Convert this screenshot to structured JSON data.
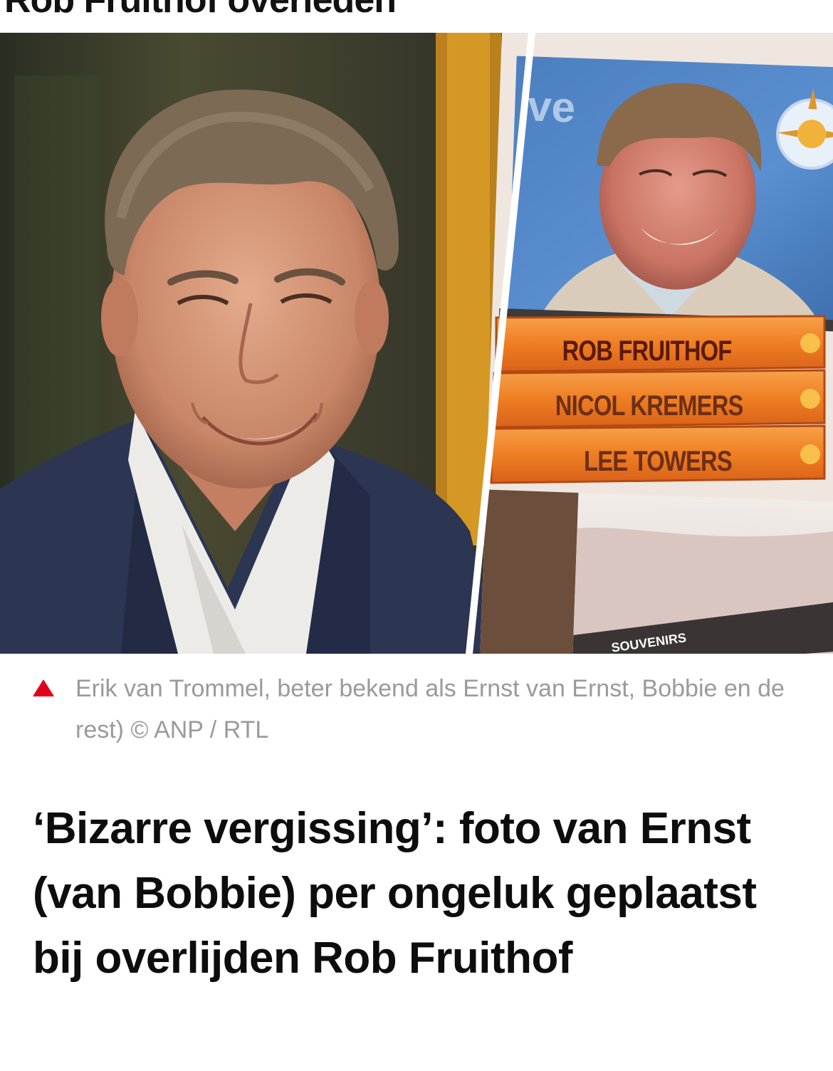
{
  "top_strip": {
    "cropped_text": "Rob Fruithof overleden"
  },
  "photo": {
    "name_panels": [
      {
        "label": "ROB FRUITHOF"
      },
      {
        "label": "NICOL KREMERS"
      },
      {
        "label": "LEE TOWERS"
      }
    ],
    "souvenir_sign": "SOUVENIRS",
    "screen_logo": "ve"
  },
  "caption": {
    "text": "Erik van Trommel, beter bekend als Ernst van Ernst, Bobbie en de rest) © ANP / RTL",
    "marker_color": "#e3001b"
  },
  "article": {
    "headline": "‘Bizarre vergissing’: foto van Ernst (van Bobbie) per ongeluk geplaatst bij overlijden Rob Fruithof"
  }
}
